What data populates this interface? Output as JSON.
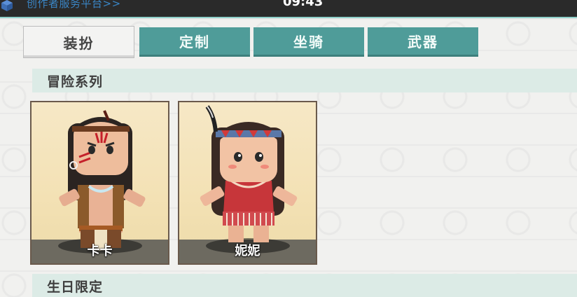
{
  "topbar": {
    "link_text": "创作者服务平台>>",
    "time": "09:43"
  },
  "tabs": [
    {
      "label": "装扮",
      "active": true
    },
    {
      "label": "定制",
      "active": false
    },
    {
      "label": "坐骑",
      "active": false
    },
    {
      "label": "武器",
      "active": false
    }
  ],
  "sections": [
    {
      "title": "冒险系列",
      "items": [
        {
          "name": "卡卡"
        },
        {
          "name": "妮妮"
        }
      ]
    },
    {
      "title": "生日限定",
      "items": []
    }
  ],
  "colors": {
    "tab_active_bg": "#f3f3f2",
    "tab_inactive_bg": "#4f9c99",
    "section_bg": "#dcebe6",
    "card_bg": "#f3e1b4"
  }
}
